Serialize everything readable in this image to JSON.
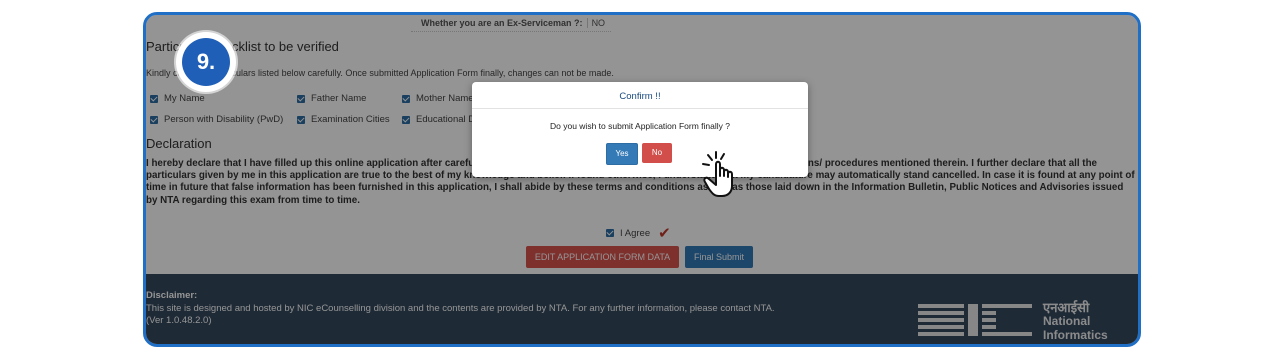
{
  "step": {
    "number": "9."
  },
  "exserviceman": {
    "label": "Whether you are an Ex-Serviceman ?:",
    "value": "NO"
  },
  "particulars": {
    "title": "Particulars checklist to be verified",
    "note": "Kindly check the particulars listed below carefully. Once submitted Application Form finally, changes can not be made.",
    "items": [
      "My Name",
      "Father Name",
      "Mother Name",
      "Person with Disability (PwD)",
      "Examination Cities",
      "Educational Details"
    ]
  },
  "declaration": {
    "title": "Declaration",
    "text": "I hereby declare that I have filled up this online application after carefully reading the Information Bulletin and fully understanding the provisions/ procedures mentioned therein. I further declare that all the particulars given by me in this application are true to the best of my knowledge and belief. If found otherwise, I understand that my candidature may automatically stand cancelled. In case it is found at any point of time in future that false information has been furnished in this application, I shall abide by these terms and conditions as well as those laid down in the Information Bulletin, Public Notices and Advisories issued by NTA regarding this exam from time to time.",
    "agree_label": "I Agree"
  },
  "buttons": {
    "edit": "EDIT APPLICATION FORM DATA",
    "final": "Final Submit"
  },
  "modal": {
    "title": "Confirm !!",
    "message": "Do you wish to submit Application Form finally ?",
    "yes": "Yes",
    "no": "No"
  },
  "footer": {
    "disclaimer_label": "Disclaimer:",
    "disclaimer_text": "This site is designed and hosted by NIC eCounselling division and the contents are provided by NTA. For any further information, please contact NTA.",
    "version": "(Ver 1.0.48.2.0)",
    "logo_hindi": "एनआईसी",
    "logo_en_1": "National",
    "logo_en_2": "Informatics"
  },
  "colors": {
    "frame": "#1f6fc6",
    "badge": "#1f5fb8",
    "footer": "#34495e",
    "primary": "#337ab7",
    "danger": "#d9534f"
  },
  "icons": {
    "pointer": "hand-pointer-icon",
    "check": "check-icon"
  }
}
